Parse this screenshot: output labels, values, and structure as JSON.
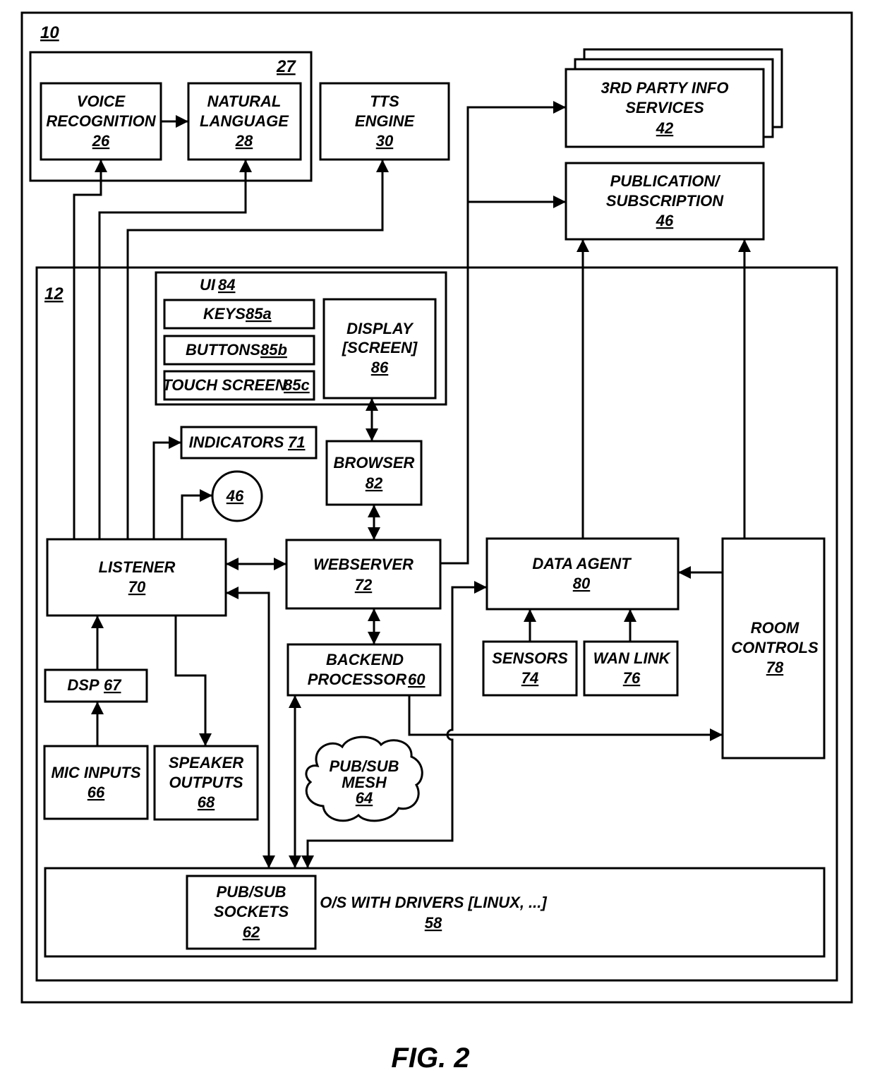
{
  "figure_label": "FIG. 2",
  "containers": {
    "system": {
      "ref": "10"
    },
    "speech_group": {
      "ref": "27"
    },
    "device": {
      "ref": "12"
    },
    "ui": {
      "label": "UI",
      "ref": "84"
    },
    "os": {
      "label": "O/S WITH DRIVERS [LINUX, ...]",
      "ref": "58"
    }
  },
  "blocks": {
    "voice_recognition": {
      "lines": [
        "VOICE",
        "RECOGNITION"
      ],
      "ref": "26"
    },
    "natural_language": {
      "lines": [
        "NATURAL",
        "LANGUAGE"
      ],
      "ref": "28"
    },
    "tts_engine": {
      "lines": [
        "TTS",
        "ENGINE"
      ],
      "ref": "30"
    },
    "third_party": {
      "lines": [
        "3RD PARTY INFO",
        "SERVICES"
      ],
      "ref": "42"
    },
    "pubsub_service": {
      "lines": [
        "PUBLICATION/",
        "SUBSCRIPTION"
      ],
      "ref": "46"
    },
    "keys": {
      "label": "KEYS",
      "ref": "85a"
    },
    "buttons": {
      "label": "BUTTONS",
      "ref": "85b"
    },
    "touch_screen": {
      "label": "TOUCH SCREEN",
      "ref": "85c"
    },
    "display": {
      "lines": [
        "DISPLAY",
        "[SCREEN]"
      ],
      "ref": "86"
    },
    "indicators": {
      "label": "INDICATORS",
      "ref": "71"
    },
    "pubsub_ref_circle": {
      "ref": "46"
    },
    "browser": {
      "lines": [
        "BROWSER"
      ],
      "ref": "82"
    },
    "listener": {
      "lines": [
        "LISTENER"
      ],
      "ref": "70"
    },
    "webserver": {
      "lines": [
        "WEBSERVER"
      ],
      "ref": "72"
    },
    "data_agent": {
      "lines": [
        "DATA AGENT"
      ],
      "ref": "80"
    },
    "room_controls": {
      "lines": [
        "ROOM",
        "CONTROLS"
      ],
      "ref": "78"
    },
    "dsp": {
      "label": "DSP",
      "ref": "67"
    },
    "backend": {
      "lines": [
        "BACKEND"
      ],
      "last_line": "PROCESSOR",
      "ref": "60"
    },
    "sensors": {
      "lines": [
        "SENSORS"
      ],
      "ref": "74"
    },
    "wan_link": {
      "lines": [
        "WAN LINK"
      ],
      "ref": "76"
    },
    "mic_inputs": {
      "lines": [
        "MIC INPUTS"
      ],
      "ref": "66"
    },
    "speaker_outputs": {
      "lines": [
        "SPEAKER",
        "OUTPUTS"
      ],
      "ref": "68"
    },
    "pubsub_mesh": {
      "lines": [
        "PUB/SUB",
        "MESH"
      ],
      "ref": "64"
    },
    "pubsub_sockets": {
      "lines": [
        "PUB/SUB",
        "SOCKETS"
      ],
      "ref": "62"
    }
  }
}
